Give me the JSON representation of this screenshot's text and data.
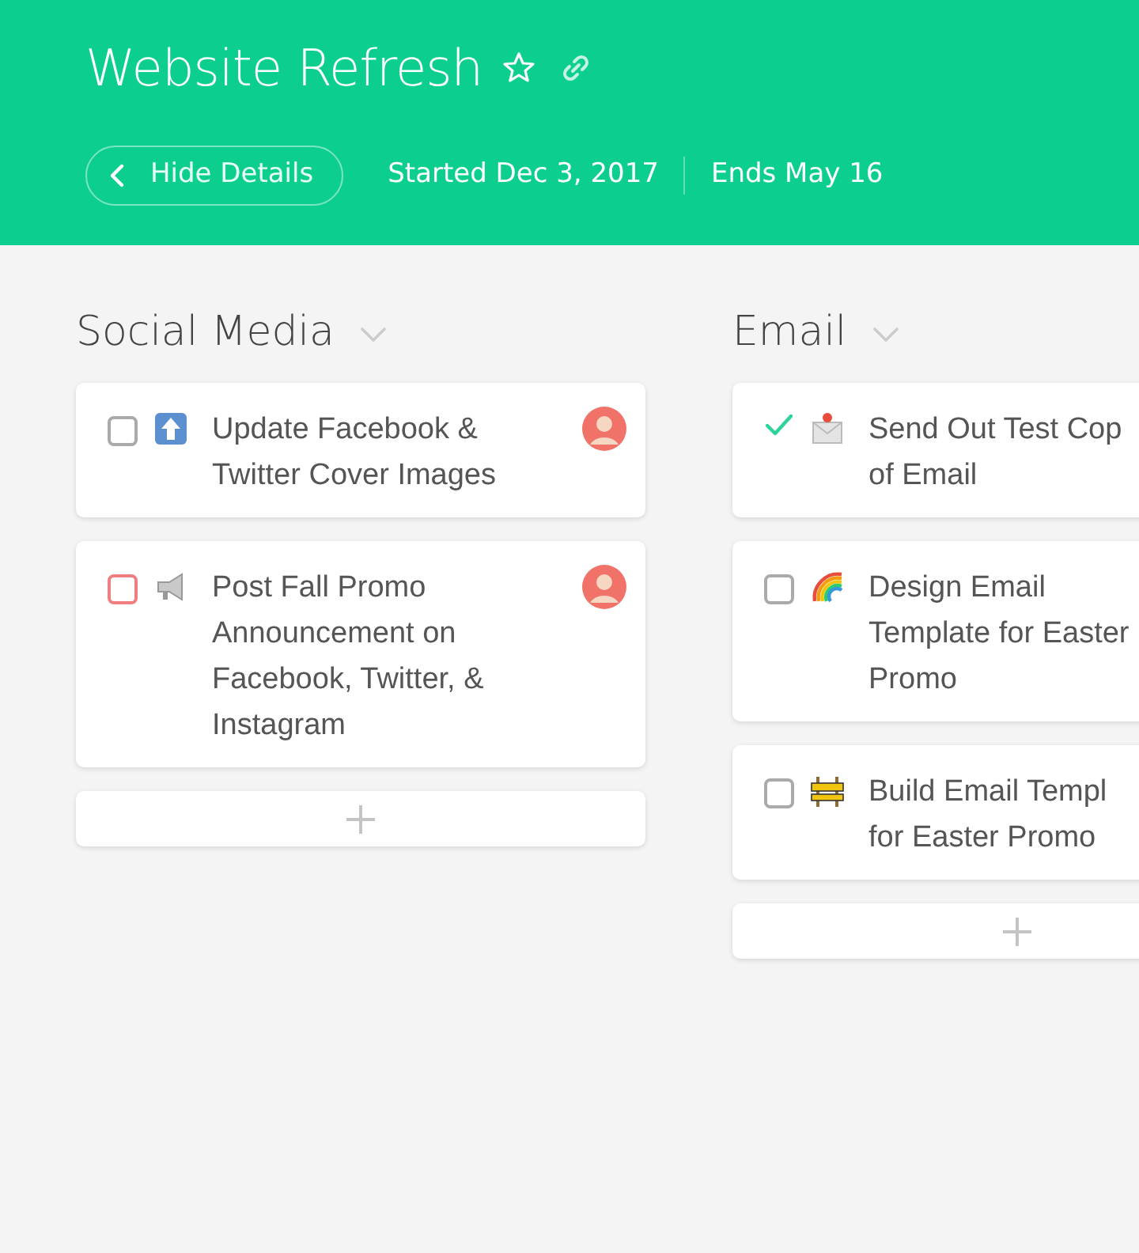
{
  "project": {
    "title": "Website Refresh",
    "starred": false,
    "back_button": "Hide Details",
    "started": "Started Dec 3, 2017",
    "ends": "Ends May 16"
  },
  "columns": [
    {
      "title": "Social Media",
      "tasks": [
        {
          "kind": "arrow",
          "lines": [
            "Update Facebook &",
            "Twitter Cover Images"
          ],
          "checked": false,
          "color": "#aaaaaa",
          "assigned": true
        },
        {
          "kind": "megaphone",
          "lines": [
            "Post Fall Promo",
            "Announcement on",
            "Facebook, Twitter, &",
            "Instagram"
          ],
          "checked": false,
          "color": "#f07e7e",
          "assigned": true
        }
      ]
    },
    {
      "title": "Email",
      "tasks": [
        {
          "kind": "envelope",
          "lines": [
            "Send Out Test Cop",
            "of Email"
          ],
          "checked": true,
          "color": "#2dd49a",
          "assigned": false
        },
        {
          "kind": "rainbow",
          "lines": [
            "Design Email",
            "Template for Easter",
            "Promo"
          ],
          "checked": false,
          "color": "#aaaaaa",
          "assigned": false
        },
        {
          "kind": "barrier",
          "lines": [
            "Build Email Templ",
            "for Easter Promo"
          ],
          "checked": false,
          "color": "#aaaaaa",
          "assigned": false
        }
      ]
    }
  ]
}
